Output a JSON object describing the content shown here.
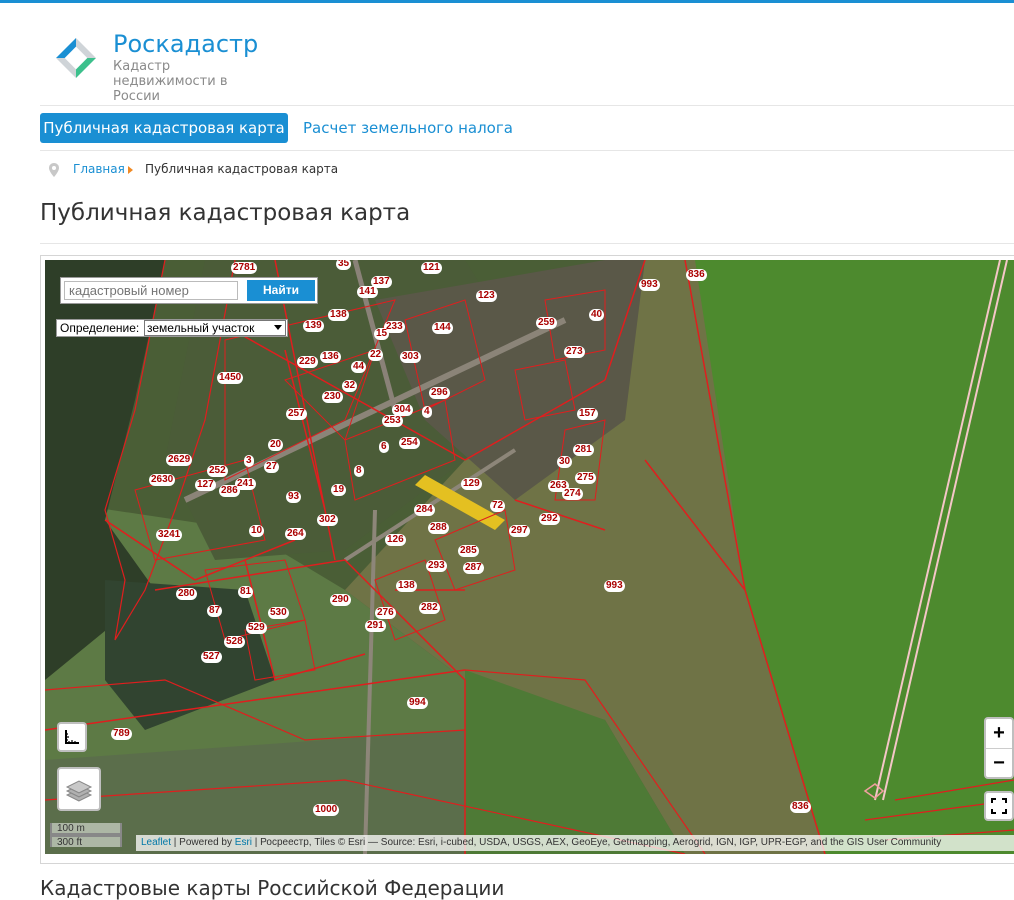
{
  "brand": {
    "title": "Роскадастр",
    "subtitle": "Кадастр недвижимости в России",
    "colors": {
      "primary": "#1a8fd3",
      "accent": "#f08a24"
    }
  },
  "nav": {
    "tabs": [
      {
        "label": "Публичная кадастровая карта",
        "active": true
      },
      {
        "label": "Расчет земельного налога",
        "active": false
      }
    ]
  },
  "breadcrumb": {
    "icon": "map-pin-icon",
    "home": "Главная",
    "current": "Публичная кадастровая карта"
  },
  "page_title": "Публичная кадастровая карта",
  "map": {
    "search": {
      "placeholder": "кадастровый номер",
      "button": "Найти"
    },
    "definition": {
      "label": "Определение:",
      "selected": "земельный участок"
    },
    "zoom": {
      "in": "+",
      "out": "−"
    },
    "scale": {
      "metric": "100 m",
      "imperial": "300 ft"
    },
    "attribution": {
      "leaflet": "Leaflet",
      "sep1": " | Powered by ",
      "esri": "Esri",
      "rest": " | Росреестр, Tiles © Esri — Source: Esri, i-cubed, USDA, USGS, AEX, GeoEye, Getmapping, Aerogrid, IGN, IGP, UPR-EGP, and the GIS User Community"
    },
    "parcels": [
      "2781",
      "35",
      "137",
      "121",
      "123",
      "836",
      "993",
      "138",
      "141",
      "233",
      "144",
      "259",
      "40",
      "139",
      "136",
      "15",
      "22",
      "303",
      "229",
      "44",
      "273",
      "1450",
      "32",
      "296",
      "230",
      "304",
      "4",
      "257",
      "253",
      "157",
      "20",
      "254",
      "6",
      "281",
      "3",
      "2629",
      "252",
      "27",
      "8",
      "30",
      "2630",
      "127",
      "241",
      "286",
      "93",
      "19",
      "129",
      "263",
      "274",
      "275",
      "72",
      "284",
      "302",
      "292",
      "10",
      "264",
      "288",
      "297",
      "3241",
      "126",
      "285",
      "293",
      "287",
      "280",
      "81",
      "993",
      "138",
      "87",
      "290",
      "276",
      "282",
      "530",
      "529",
      "528",
      "527",
      "291",
      "994",
      "789",
      "1000",
      "836"
    ]
  },
  "bottom_title": "Кадастровые карты Российской Федерации"
}
